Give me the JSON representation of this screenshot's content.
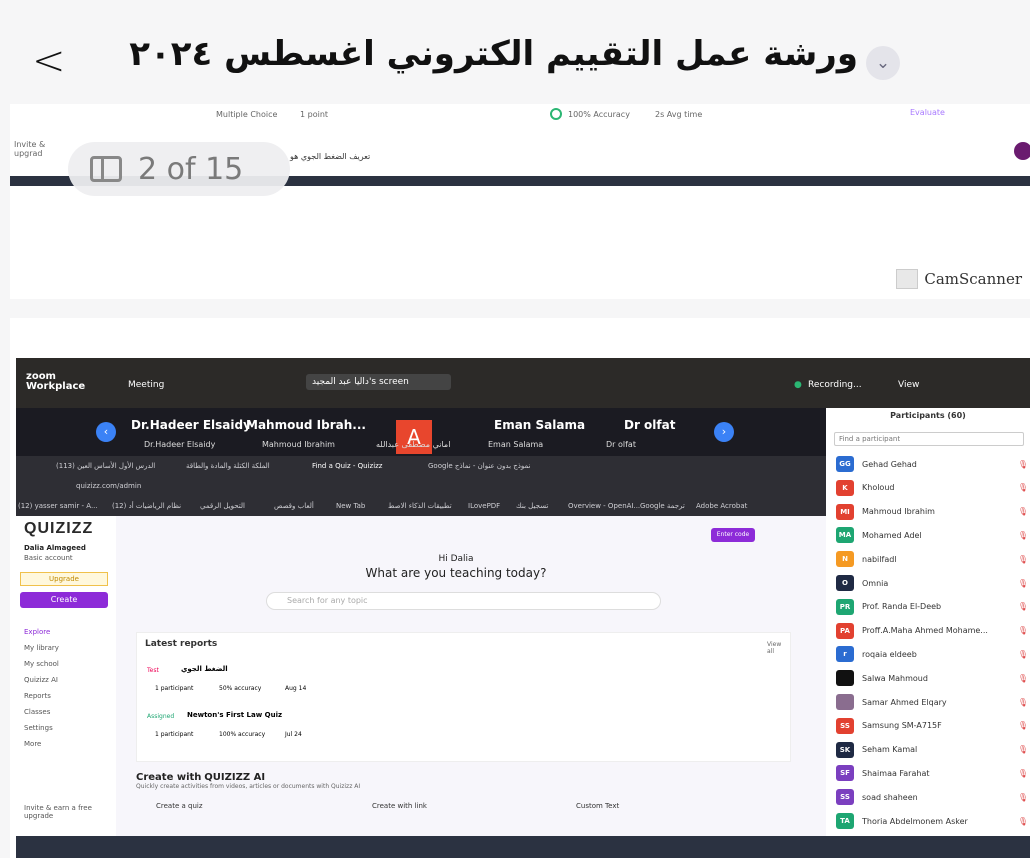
{
  "header": {
    "back_icon": "chevron-left-icon",
    "title": "ورشة عمل التقييم الكتروني اغسطس ٢٠٢٤",
    "expand_icon": "chevron-down-icon"
  },
  "page_counter": {
    "label": "2 of 15",
    "icon": "sidebar-panel-icon"
  },
  "page1": {
    "multiple_choice": "Multiple Choice",
    "points": "1 point",
    "accuracy": "100% Accuracy",
    "avg_time": "2s Avg time",
    "evaluate": "Evaluate",
    "invite": "Invite & upgrad",
    "question": "تعريف الضغط الجوي هو",
    "camscanner": "CamScanner"
  },
  "zoom": {
    "app": "zoom Workplace",
    "meeting": "Meeting",
    "screen_label": "داليا عبد المجيد's screen",
    "recording": "Recording...",
    "view": "View",
    "gallery": [
      {
        "name": "Dr.Hadeer Elsaidy",
        "sub": "Dr.Hadeer Elsaidy"
      },
      {
        "name": "Mahmoud Ibrah...",
        "sub": "Mahmoud Ibrahim"
      },
      {
        "name": "A",
        "sub": "اماني مصطفى عبدالله"
      },
      {
        "name": "Eman Salama",
        "sub": "Eman Salama"
      },
      {
        "name": "Dr olfat",
        "sub": "Dr olfat"
      }
    ]
  },
  "browser": {
    "url": "quizizz.com/admin",
    "tabs": [
      "الدرس الأول الأساس العين (113)",
      "الملكة الكتلة والمادة والطاقة",
      "Find a Quiz - Quizizz",
      "Google نموذج بدون عنوان - نماذج"
    ],
    "bookmarks": [
      "(12) yasser samir - A...",
      "(12) نظام الرياضيات أد",
      "التحويل الرقمي",
      "ألعاب وقصص",
      "New Tab",
      "تطبيقات الذكاء الاصط",
      "ILovePDF",
      "تسجيل بنك",
      "Overview - OpenAI...",
      "Google ترجمة",
      "Adobe Acrobat"
    ]
  },
  "quizizz": {
    "brand": "QUIZIZZ",
    "user": "Dalia Almageed",
    "plan": "Basic account",
    "upgrade": "Upgrade",
    "create": "Create",
    "nav": [
      "Explore",
      "My library",
      "My school",
      "Quizizz AI",
      "Reports",
      "Classes",
      "Settings",
      "More"
    ],
    "invite": "Invite & earn a free upgrade",
    "enter_code": "Enter code",
    "greeting": "Hi Dalia",
    "question": "What are you teaching today?",
    "search_placeholder": "Search for any topic",
    "latest_reports": "Latest reports",
    "view_all": "View all",
    "reports": [
      {
        "tag": "Test",
        "title": "الضغط الجوي",
        "participants": "1 participant",
        "accuracy": "50% accuracy",
        "date": "Aug 14"
      },
      {
        "tag": "Assigned",
        "title": "Newton's First Law Quiz",
        "participants": "1 participant",
        "accuracy": "100% accuracy",
        "date": "Jul 24"
      }
    ],
    "create_with": "Create with",
    "create_with_brand": "QUIZIZZ AI",
    "create_sub": "Quickly create activities from videos, articles or documents with Quizizz AI",
    "options": [
      "Create a quiz",
      "Create with link",
      "Custom Text"
    ]
  },
  "participants": {
    "title": "Participants (60)",
    "find": "Find a participant",
    "list": [
      {
        "initials": "GG",
        "name": "Gehad Gehad",
        "color": "#2b6cd1"
      },
      {
        "initials": "K",
        "name": "Kholoud",
        "color": "#e24130"
      },
      {
        "initials": "MI",
        "name": "Mahmoud Ibrahim",
        "color": "#e24130"
      },
      {
        "initials": "MA",
        "name": "Mohamed Adel",
        "color": "#1ea672"
      },
      {
        "initials": "N",
        "name": "nabilfadl",
        "color": "#f59a23"
      },
      {
        "initials": "O",
        "name": "Omnia",
        "color": "#1f2a44"
      },
      {
        "initials": "PR",
        "name": "Prof. Randa El-Deeb",
        "color": "#1ea672"
      },
      {
        "initials": "PA",
        "name": "Proff.A.Maha Ahmed Mohame...",
        "color": "#e24130"
      },
      {
        "initials": "r",
        "name": "roqaia eldeeb",
        "color": "#2b6cd1"
      },
      {
        "initials": "",
        "name": "Salwa Mahmoud",
        "color": "#111111"
      },
      {
        "initials": "",
        "name": "Samar Ahmed Elqary",
        "color": "#8a6d8f"
      },
      {
        "initials": "SS",
        "name": "Samsung SM-A715F",
        "color": "#e24130"
      },
      {
        "initials": "SK",
        "name": "Seham Kamal",
        "color": "#1f2a44"
      },
      {
        "initials": "SF",
        "name": "Shaimaa Farahat",
        "color": "#7b3fbf"
      },
      {
        "initials": "SS",
        "name": "soad shaheen",
        "color": "#7b3fbf"
      },
      {
        "initials": "TA",
        "name": "Thoria Abdelmonem Asker",
        "color": "#1ea672"
      }
    ]
  }
}
